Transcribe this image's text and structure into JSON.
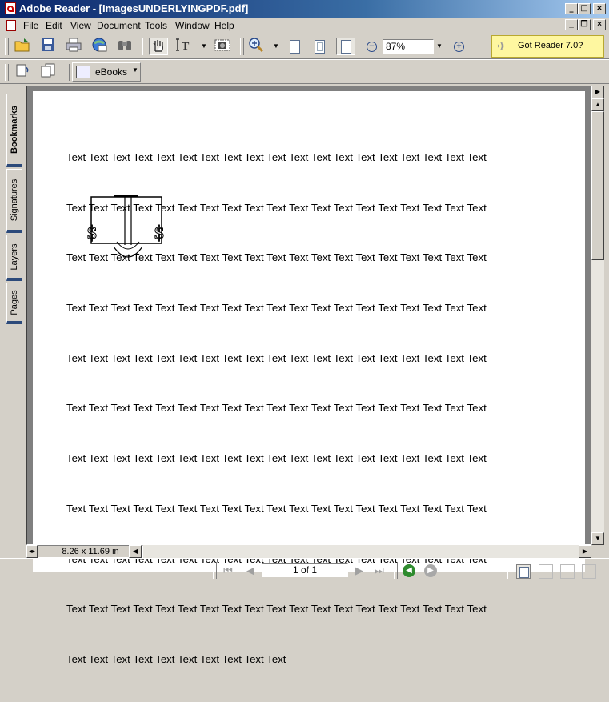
{
  "window": {
    "title": "Adobe Reader - [ImagesUNDERLYINGPDF.pdf]",
    "caption_buttons": {
      "minimize": "_",
      "maximize": "□",
      "close": "×"
    },
    "doc_buttons": {
      "minimize": "_",
      "restore": "❐",
      "close": "×"
    }
  },
  "menu": {
    "items": [
      "File",
      "Edit",
      "View",
      "Document",
      "Tools",
      "Window",
      "Help"
    ]
  },
  "toolbar": {
    "icons": {
      "open": "folder-open-icon",
      "save": "save-icon",
      "print": "printer-icon",
      "email": "email-icon",
      "search": "binoculars-icon",
      "hand": "hand-icon",
      "select_text": "select-text-icon",
      "snapshot": "snapshot-icon",
      "zoom_in": "zoom-in-icon"
    },
    "zoom_value": "87%",
    "got_reader_label": "Got Reader 7.0?",
    "ebooks_label": "eBooks"
  },
  "nav_tabs": [
    "Bookmarks",
    "Signatures",
    "Layers",
    "Pages"
  ],
  "document": {
    "text_lines": [
      "Text Text Text Text Text Text Text Text Text Text Text Text Text Text Text Text Text Text Text",
      "Text Text Text Text Text Text Text Text Text Text Text Text Text Text Text Text Text Text Text",
      "Text Text Text Text Text Text Text Text Text Text Text Text Text Text Text Text Text Text Text",
      "Text Text Text Text Text Text Text Text Text Text Text Text Text Text Text Text Text Text Text",
      "Text Text Text Text Text Text Text Text Text Text Text Text Text Text Text Text Text Text Text",
      "Text Text Text Text Text Text Text Text Text Text Text Text Text Text Text Text Text Text Text",
      "Text Text Text Text Text Text Text Text Text Text Text Text Text Text Text Text Text Text Text",
      "Text Text Text Text Text Text Text Text Text Text Text Text Text Text Text Text Text Text Text",
      "Text Text Text Text Text Text Text Text Text Text Text Text Text Text Text Text Text Text Text",
      "Text Text Text Text Text Text Text Text Text Text Text Text Text Text Text Text Text Text Text",
      "Text Text Text Text Text Text Text Text Text Text"
    ]
  },
  "status": {
    "page_size": "8.26 x 11.69 in",
    "page_indicator": "1 of 1"
  }
}
